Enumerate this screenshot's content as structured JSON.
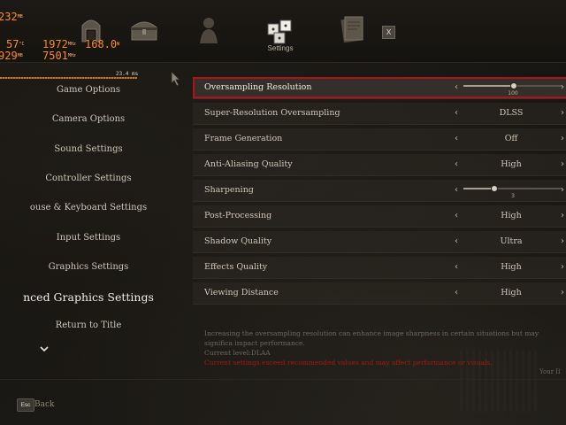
{
  "perf_overlay": {
    "gpu_temp": "232",
    "gpu_temp_unit": "MB",
    "cpu_temp": "57",
    "cpu_temp_unit": "°C",
    "gpu_clock": "1972",
    "gpu_clock_unit": "MHz",
    "power": "168.0",
    "power_unit": "W",
    "vram": "929",
    "vram_unit": "MB",
    "mem_clock": "7501",
    "mem_clock_unit": "MHz",
    "frametime": "23.4 ms"
  },
  "top_tabs": {
    "active_label": "Settings",
    "close_label": "X"
  },
  "left_menu": [
    {
      "label": "Game Options",
      "active": false
    },
    {
      "label": "Camera Options",
      "active": false
    },
    {
      "label": "Sound Settings",
      "active": false
    },
    {
      "label": "Controller Settings",
      "active": false
    },
    {
      "label": "ouse & Keyboard Settings",
      "active": false
    },
    {
      "label": "Input Settings",
      "active": false
    },
    {
      "label": "Graphics Settings",
      "active": false
    },
    {
      "label": "nced Graphics Settings",
      "active": true
    },
    {
      "label": "Return to Title",
      "active": false
    }
  ],
  "settings": [
    {
      "label": "Oversampling Resolution",
      "type": "slider",
      "value": "100",
      "level": 0.5,
      "selected": true
    },
    {
      "label": "Super-Resolution Oversampling",
      "type": "select",
      "value": "DLSS"
    },
    {
      "label": "Frame Generation",
      "type": "select",
      "value": "Off"
    },
    {
      "label": "Anti-Aliasing Quality",
      "type": "select",
      "value": "High"
    },
    {
      "label": "Sharpening",
      "type": "slider",
      "value": "3",
      "level": 0.3
    },
    {
      "label": "Post-Processing",
      "type": "select",
      "value": "High"
    },
    {
      "label": "Shadow Quality",
      "type": "select",
      "value": "Ultra"
    },
    {
      "label": "Effects Quality",
      "type": "select",
      "value": "High"
    },
    {
      "label": "Viewing Distance",
      "type": "select",
      "value": "High"
    }
  ],
  "description": {
    "text": "Increasing the oversampling resolution can enhance image sharpness in certain situations but may significa impact performance.",
    "current_level": "Current level:DLAA",
    "warning": "Current settings exceed recommended values and may affect performance or visuals.",
    "footer_fragment": "Your Il"
  },
  "footer": {
    "back_key": "Esc",
    "back_label": "Back"
  },
  "colors": {
    "selection_border": "#b0121a",
    "warning": "#a21818",
    "overlay": "#ff8a1a"
  }
}
